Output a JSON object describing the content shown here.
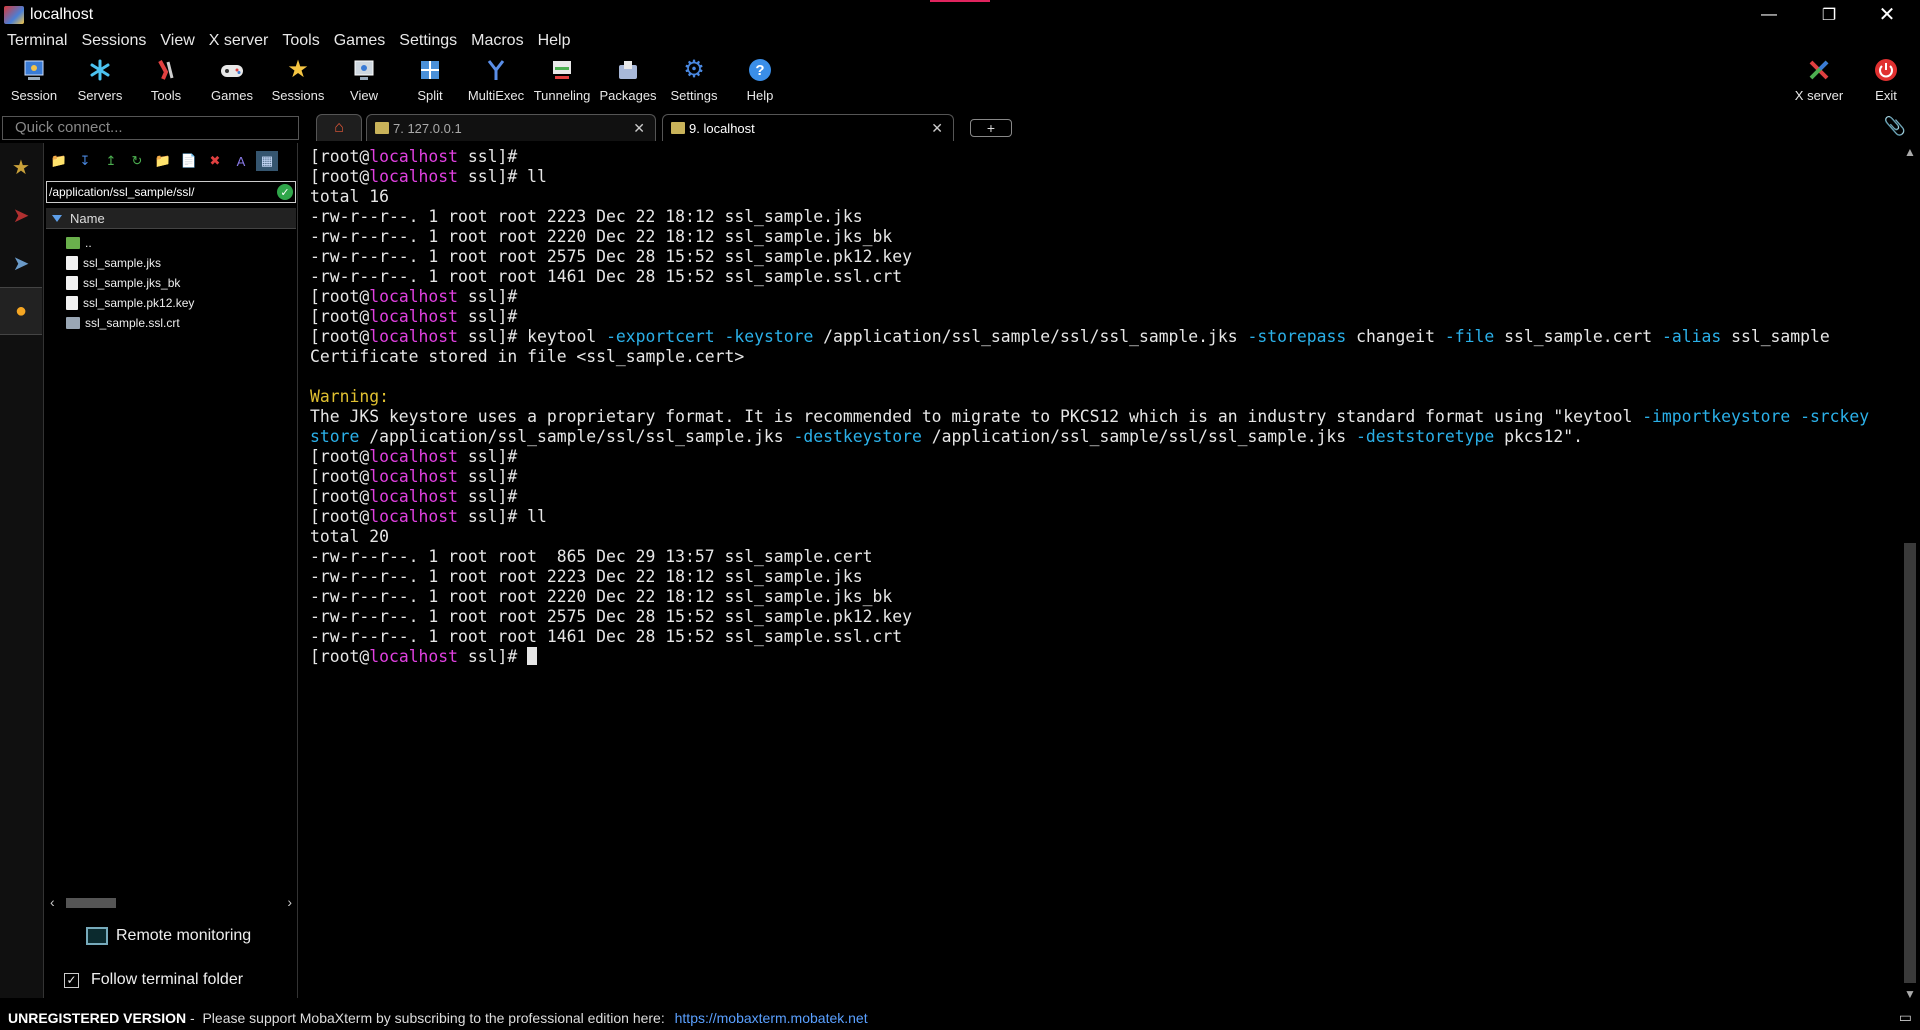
{
  "window": {
    "title": "localhost"
  },
  "menu": [
    "Terminal",
    "Sessions",
    "View",
    "X server",
    "Tools",
    "Games",
    "Settings",
    "Macros",
    "Help"
  ],
  "toolbar": {
    "buttons": [
      {
        "label": "Session",
        "icon": "session-icon"
      },
      {
        "label": "Servers",
        "icon": "servers-icon"
      },
      {
        "label": "Tools",
        "icon": "tools-icon"
      },
      {
        "label": "Games",
        "icon": "games-icon"
      },
      {
        "label": "Sessions",
        "icon": "star-icon"
      },
      {
        "label": "View",
        "icon": "view-icon"
      },
      {
        "label": "Split",
        "icon": "split-icon"
      },
      {
        "label": "MultiExec",
        "icon": "multiexec-icon"
      },
      {
        "label": "Tunneling",
        "icon": "tunneling-icon"
      },
      {
        "label": "Packages",
        "icon": "packages-icon"
      },
      {
        "label": "Settings",
        "icon": "gear-icon"
      },
      {
        "label": "Help",
        "icon": "help-icon"
      }
    ],
    "xserver_label": "X server",
    "exit_label": "Exit"
  },
  "quick_connect": {
    "placeholder": "Quick connect..."
  },
  "tabs": [
    {
      "label": "7. 127.0.0.1",
      "active": false
    },
    {
      "label": "9. localhost",
      "active": true
    }
  ],
  "sftp": {
    "path": "/application/ssl_sample/ssl/",
    "column_name": "Name",
    "files": [
      "..",
      "ssl_sample.jks",
      "ssl_sample.jks_bk",
      "ssl_sample.pk12.key",
      "ssl_sample.ssl.crt"
    ],
    "remote_monitoring": "Remote monitoring",
    "follow_folder": "Follow terminal folder"
  },
  "terminal": {
    "prompt_user": "[root@",
    "prompt_host": "localhost",
    "prompt_dir": " ssl]#",
    "lines": [
      {
        "t": "prompt",
        "cmd": ""
      },
      {
        "t": "prompt",
        "cmd": " ll"
      },
      {
        "t": "text",
        "text": "total 16"
      },
      {
        "t": "text",
        "text": "-rw-r--r--. 1 root root 2223 Dec 22 18:12 ssl_sample.jks"
      },
      {
        "t": "text",
        "text": "-rw-r--r--. 1 root root 2220 Dec 22 18:12 ssl_sample.jks_bk"
      },
      {
        "t": "text",
        "text": "-rw-r--r--. 1 root root 2575 Dec 28 15:52 ssl_sample.pk12.key"
      },
      {
        "t": "text",
        "text": "-rw-r--r--. 1 root root 1461 Dec 28 15:52 ssl_sample.ssl.crt"
      },
      {
        "t": "prompt",
        "cmd": ""
      },
      {
        "t": "prompt",
        "cmd": ""
      },
      {
        "t": "keytool"
      },
      {
        "t": "text",
        "text": "Certificate stored in file <ssl_sample.cert>"
      },
      {
        "t": "text",
        "text": ""
      },
      {
        "t": "warn",
        "text": "Warning:"
      },
      {
        "t": "jks1"
      },
      {
        "t": "jks2"
      },
      {
        "t": "prompt",
        "cmd": ""
      },
      {
        "t": "prompt",
        "cmd": ""
      },
      {
        "t": "prompt",
        "cmd": ""
      },
      {
        "t": "prompt",
        "cmd": " ll"
      },
      {
        "t": "text",
        "text": "total 20"
      },
      {
        "t": "text",
        "text": "-rw-r--r--. 1 root root  865 Dec 29 13:57 ssl_sample.cert"
      },
      {
        "t": "text",
        "text": "-rw-r--r--. 1 root root 2223 Dec 22 18:12 ssl_sample.jks"
      },
      {
        "t": "text",
        "text": "-rw-r--r--. 1 root root 2220 Dec 22 18:12 ssl_sample.jks_bk"
      },
      {
        "t": "text",
        "text": "-rw-r--r--. 1 root root 2575 Dec 28 15:52 ssl_sample.pk12.key"
      },
      {
        "t": "text",
        "text": "-rw-r--r--. 1 root root 1461 Dec 28 15:52 ssl_sample.ssl.crt"
      },
      {
        "t": "cursor"
      }
    ],
    "keytool": {
      "cmd": " keytool ",
      "o1": "-exportcert",
      "o2": "-keystore",
      "p1": " /application/ssl_sample/ssl/ssl_sample.jks ",
      "o3": "-storepass",
      "p2": " changeit ",
      "o4": "-file",
      "p3": " ssl_sample.cert ",
      "o5": "-alias",
      "p4": " ssl_sample"
    },
    "jks1": {
      "a": "The JKS keystore uses a proprietary format. It is recommended to migrate to PKCS12 which is an industry standard format using \"keytool ",
      "b": "-importkeystore -srckey"
    },
    "jks2": {
      "a": "store",
      "b": " /application/ssl_sample/ssl/ssl_sample.jks ",
      "c": "-destkeystore",
      "d": " /application/ssl_sample/ssl/ssl_sample.jks ",
      "e": "-deststoretype",
      "f": " pkcs12\"."
    }
  },
  "status": {
    "unregistered": "UNREGISTERED VERSION",
    "message": " -  Please support MobaXterm by subscribing to the professional edition here: ",
    "link": "https://mobaxterm.mobatek.net"
  },
  "colors": {
    "host": "#e040e0",
    "option": "#2bb0e8",
    "warning": "#e0c030",
    "link": "#5aa0ff"
  }
}
